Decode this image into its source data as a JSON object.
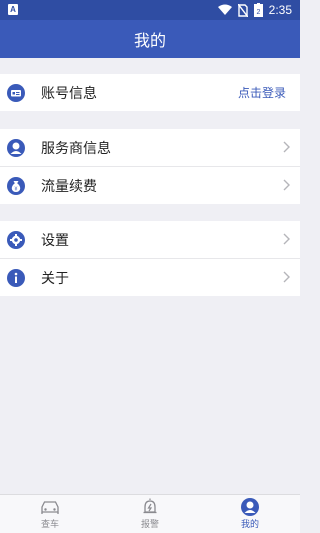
{
  "status_bar": {
    "left_icon_letter": "A",
    "time": "2:35",
    "battery_level": "2"
  },
  "header": {
    "title": "我的"
  },
  "groups": [
    {
      "items": [
        {
          "label": "账号信息",
          "right_text": "点击登录",
          "icon": "id-card-icon"
        }
      ]
    },
    {
      "items": [
        {
          "label": "服务商信息",
          "icon": "user-icon"
        },
        {
          "label": "流量续费",
          "icon": "money-bag-icon"
        }
      ]
    },
    {
      "items": [
        {
          "label": "设置",
          "icon": "gear-icon"
        },
        {
          "label": "关于",
          "icon": "info-icon"
        }
      ]
    }
  ],
  "tabs": [
    {
      "label": "查车",
      "icon": "car-icon",
      "active": false
    },
    {
      "label": "报警",
      "icon": "alarm-icon",
      "active": false
    },
    {
      "label": "我的",
      "icon": "user-icon",
      "active": true
    }
  ],
  "colors": {
    "primary": "#3a5ab9",
    "status_bar": "#2f4da3",
    "background": "#efeff4",
    "inactive_tab": "#8a8a8f"
  }
}
